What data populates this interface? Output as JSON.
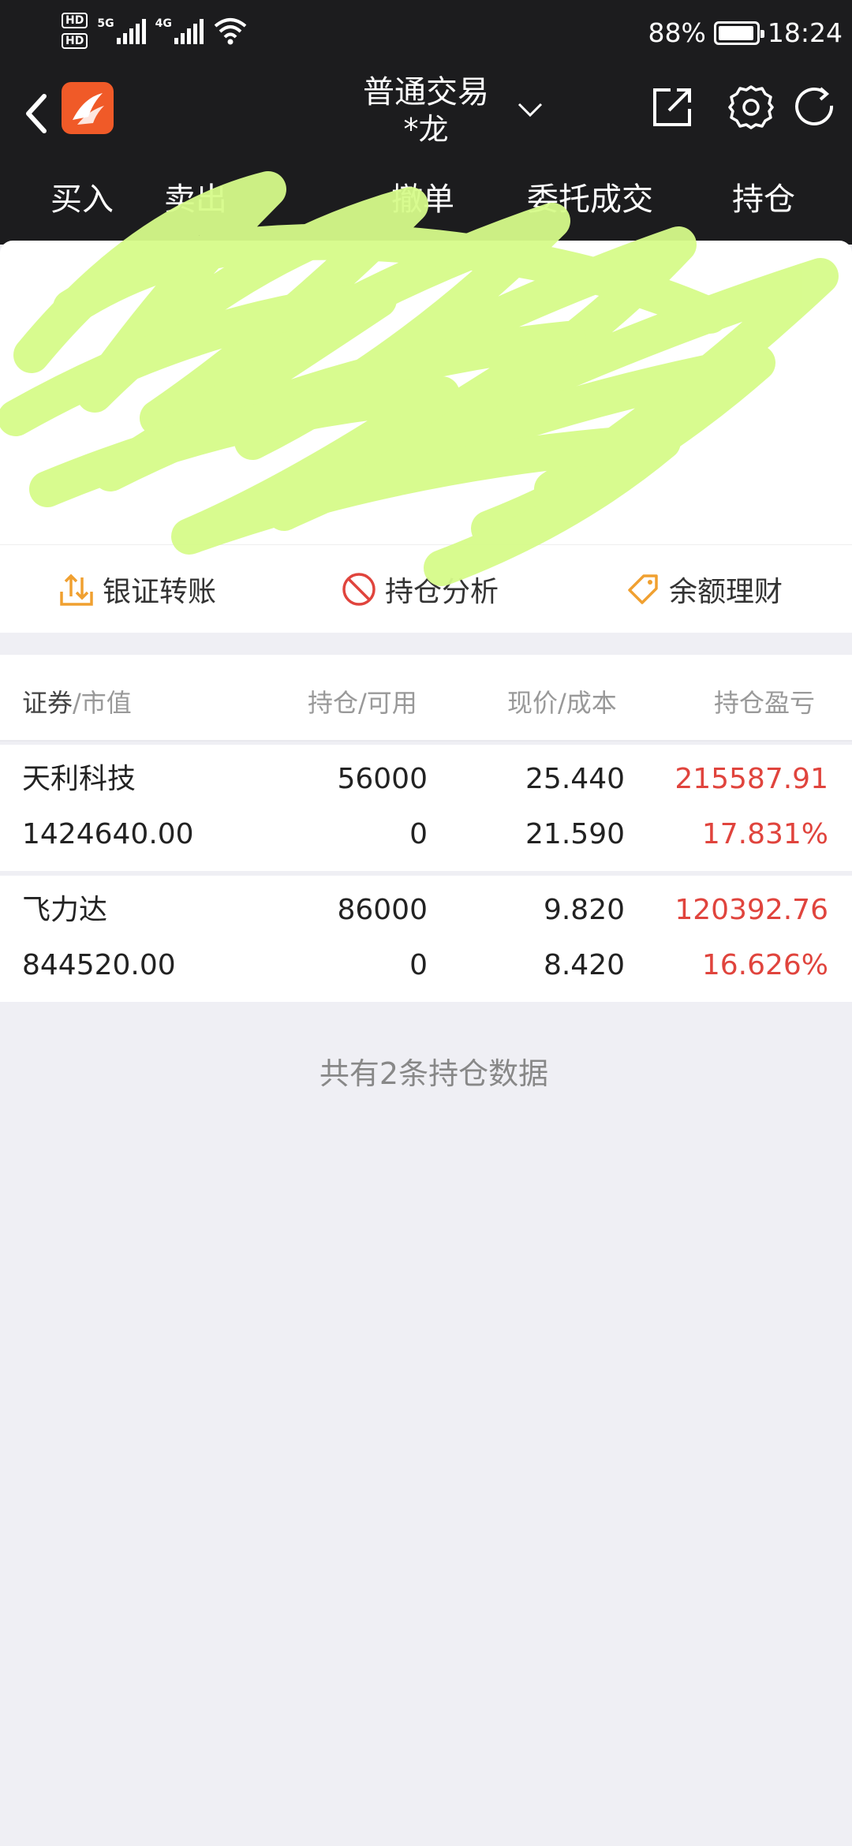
{
  "status_bar": {
    "hd1": "HD",
    "hd2": "HD",
    "net1": "5G",
    "net2": "4G",
    "battery": "88%",
    "time": "18:24"
  },
  "header": {
    "title": "普通交易",
    "account": "*龙",
    "icons": [
      "back-icon",
      "app-logo-icon",
      "chevron-down-icon",
      "share-icon",
      "gear-icon",
      "refresh-icon"
    ]
  },
  "tabs": [
    {
      "label": "买入"
    },
    {
      "label": "卖出"
    },
    {
      "label": "撤单"
    },
    {
      "label": "委托成交"
    },
    {
      "label": "持仓"
    }
  ],
  "quick_actions": [
    {
      "label": "银证转账",
      "icon": "transfer-icon"
    },
    {
      "label": "持仓分析",
      "icon": "analysis-icon"
    },
    {
      "label": "余额理财",
      "icon": "wealth-icon"
    }
  ],
  "table": {
    "headers": {
      "col1_a": "证券",
      "col1_b": "/市值",
      "col2": "持仓/可用",
      "col3": "现价/成本",
      "col4": "持仓盈亏"
    },
    "rows": [
      {
        "name": "天利科技",
        "market_value": "1424640.00",
        "position": "56000",
        "available": "0",
        "price": "25.440",
        "cost": "21.590",
        "pnl": "215587.91",
        "pnl_pct": "17.831%"
      },
      {
        "name": "飞力达",
        "market_value": "844520.00",
        "position": "86000",
        "available": "0",
        "price": "9.820",
        "cost": "8.420",
        "pnl": "120392.76",
        "pnl_pct": "16.626%"
      }
    ]
  },
  "footer_note": "共有2条持仓数据",
  "colors": {
    "bar_bg": "#1c1c1e",
    "page_bg": "#efeff4",
    "profit_red": "#e0443d",
    "logo_orange": "#f05a28",
    "redaction_green": "#d6fb8a"
  }
}
